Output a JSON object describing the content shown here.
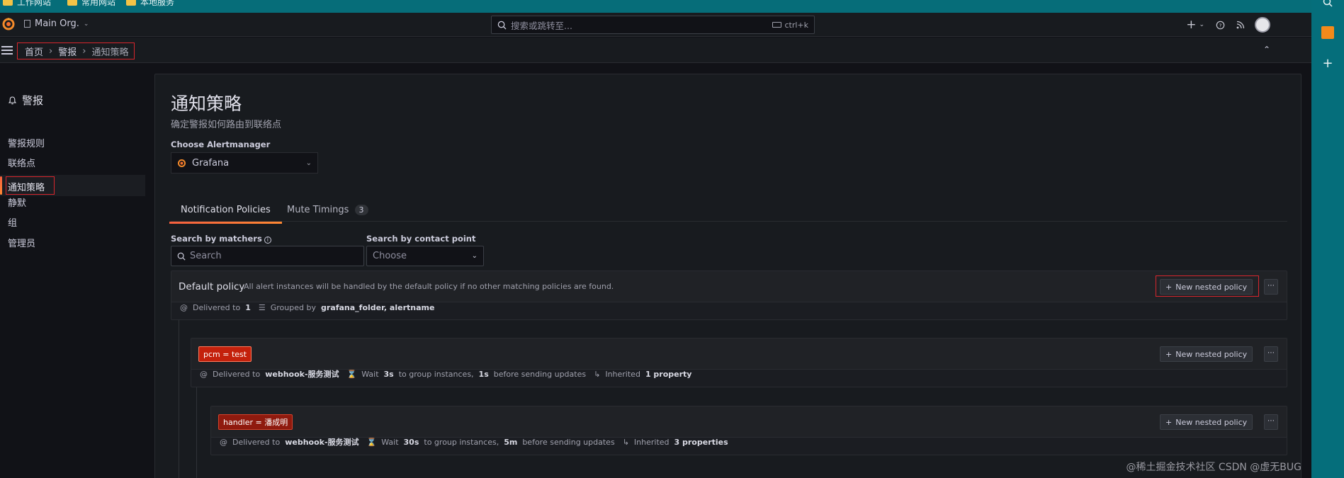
{
  "bookmarks": [
    {
      "label": "工作网站"
    },
    {
      "label": "常用网站"
    },
    {
      "label": "本地服务"
    }
  ],
  "topnav": {
    "org_label": "Main Org.",
    "search_placeholder": "搜索或跳转至...",
    "search_shortcut": "ctrl+k",
    "plus_label": "+",
    "help_icon": "help-icon",
    "rss_icon": "rss-icon"
  },
  "breadcrumb": {
    "items": [
      "首页",
      "警报",
      "通知策略"
    ],
    "separator": "›"
  },
  "leftnav": {
    "section_title": "警报",
    "items": [
      "警报规则",
      "联络点",
      "通知策略",
      "静默",
      "组",
      "管理员"
    ],
    "active_index": 2
  },
  "page": {
    "title": "通知策略",
    "subtitle": "确定警报如何路由到联络点",
    "alertmanager_label": "Choose Alertmanager",
    "alertmanager_value": "Grafana"
  },
  "tabs": [
    {
      "label": "Notification Policies",
      "active": true
    },
    {
      "label": "Mute Timings",
      "count": "3",
      "active": false
    }
  ],
  "search": {
    "matchers_label": "Search by matchers",
    "matchers_placeholder": "Search",
    "contact_label": "Search by contact point",
    "contact_placeholder": "Choose"
  },
  "policies": {
    "default": {
      "title": "Default policy",
      "description": "All alert instances will be handled by the default policy if no other matching policies are found.",
      "new_nested_label": "New nested policy",
      "delivered_prefix": "Delivered to",
      "delivered_count": "1",
      "grouped_prefix": "Grouped by",
      "grouped_by": "grafana_folder, alertname"
    },
    "child1": {
      "matcher": "pcm = test",
      "new_nested_label": "New nested policy",
      "delivered_prefix": "Delivered to",
      "delivered_to": "webhook-服务测试",
      "wait_prefix": "Wait",
      "wait_value": "3s",
      "wait_mid": "to group instances,",
      "before_value": "1s",
      "before_suffix": "before sending updates",
      "inherited_prefix": "Inherited",
      "inherited_value": "1 property"
    },
    "child2": {
      "matcher": "handler = 潘成明",
      "new_nested_label": "New nested policy",
      "delivered_prefix": "Delivered to",
      "delivered_to": "webhook-服务测试",
      "wait_prefix": "Wait",
      "wait_value": "30s",
      "wait_mid": "to group instances,",
      "before_value": "5m",
      "before_suffix": "before sending updates",
      "inherited_prefix": "Inherited",
      "inherited_value": "3 properties"
    }
  },
  "watermark": "@稀土掘金技术社区 CSDN @虚无BUG",
  "colors": {
    "accent": "#ff8833",
    "highlight_red": "#d7262d",
    "matcher_red": "#c4210c",
    "bookmark_bar": "#066d79"
  }
}
